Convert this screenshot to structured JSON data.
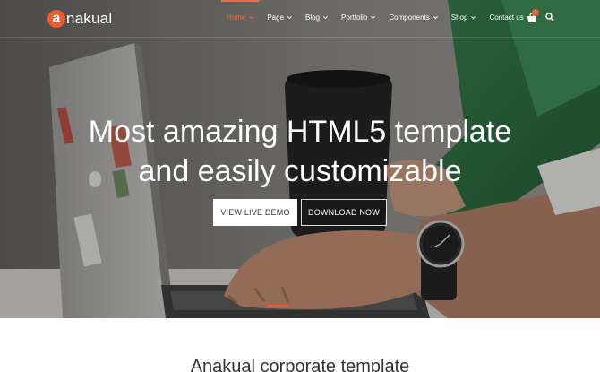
{
  "brand": {
    "logo_letter": "a",
    "name": "nakual",
    "accent": "#ee5a2b"
  },
  "nav": {
    "items": [
      {
        "label": "Home",
        "dropdown": true,
        "active": true
      },
      {
        "label": "Page",
        "dropdown": true
      },
      {
        "label": "Blog",
        "dropdown": true
      },
      {
        "label": "Portfolio",
        "dropdown": true
      },
      {
        "label": "Components",
        "dropdown": true
      },
      {
        "label": "Shop",
        "dropdown": true
      },
      {
        "label": "Contact us",
        "dropdown": false
      }
    ],
    "cart_icon": "shopping-bag-icon",
    "cart_count": "1",
    "search_icon": "search-icon"
  },
  "hero": {
    "headline_line1": "Most amazing HTML5 template",
    "headline_line2": "and easily customizable",
    "primary_button": "VIEW LIVE DEMO",
    "secondary_button": "DOWNLOAD NOW"
  },
  "section": {
    "title": "Anakual corporate template"
  }
}
